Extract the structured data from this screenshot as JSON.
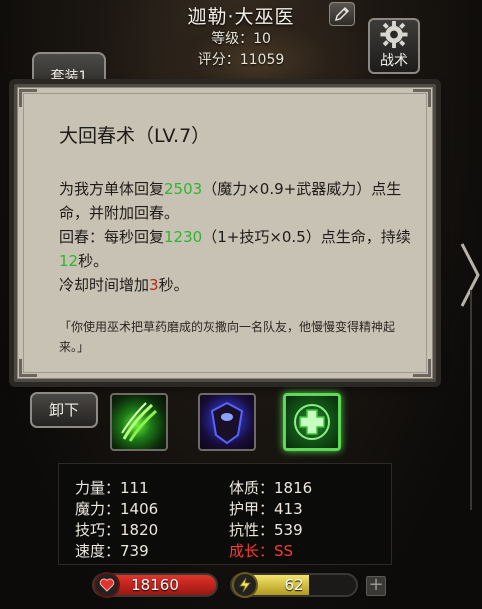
{
  "hero": {
    "name": "迦勒·大巫医",
    "level_text": "等级：10",
    "score_text": "评分：11059"
  },
  "buttons": {
    "tactics_label": "战术",
    "suit_tab_label": "套装1",
    "unequip_label": "卸下"
  },
  "tooltip": {
    "title": "大回春术（LV.7）",
    "line1_pre": "为我方单体回复",
    "heal_value": "2503",
    "line1_post": "（魔力×0.9+武器威力）点生命，并附加回春。",
    "line2_pre": "回春：每秒回复",
    "hot_value": "1230",
    "line2_mid": "（1+技巧×0.5）点生命，持续",
    "duration_value": "12",
    "line2_post": "秒。",
    "line3_pre": "冷却时间增加",
    "cooldown_value": "3",
    "line3_post": "秒。",
    "quote": "「你使用巫术把草药磨成的灰撒向一名队友，他慢慢变得精神起来。」"
  },
  "skills": [
    {
      "icon": "green-claw-skill-icon"
    },
    {
      "icon": "dark-shield-skill-icon"
    },
    {
      "icon": "green-cross-heal-skill-icon",
      "selected": true
    }
  ],
  "stats": {
    "strength": "力量：111",
    "constitution": "体质：1816",
    "magic": "魔力：1406",
    "armor": "护甲：413",
    "skill": "技巧：1820",
    "resistance": "抗性：539",
    "speed": "速度：739",
    "growth": "成长：SS"
  },
  "bars": {
    "hp_value": "18160",
    "energy_value": "62",
    "energy_fraction": 0.62
  },
  "colors": {
    "heal_green": "#2fb52f",
    "cooldown_red": "#b22a1c",
    "growth_red": "#ff3a2a",
    "selected_glow": "#5fd85a"
  }
}
